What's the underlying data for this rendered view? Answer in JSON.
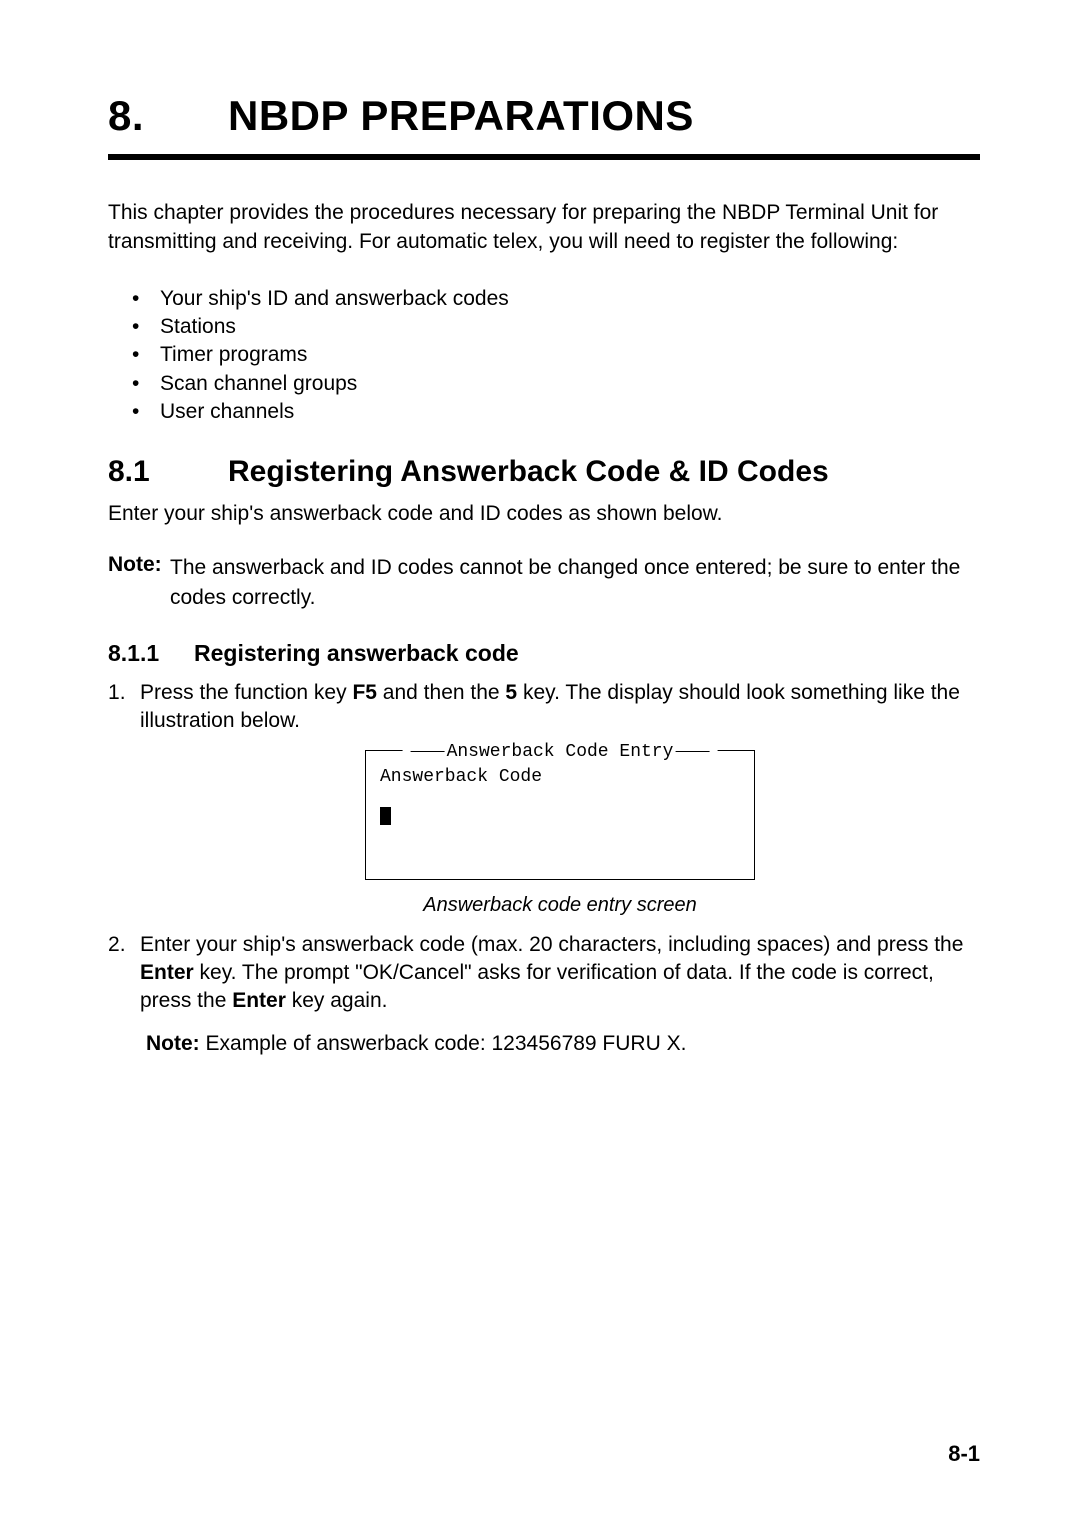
{
  "chapter": {
    "number": "8.",
    "title": "NBDP PREPARATIONS"
  },
  "intro": "This chapter provides the procedures necessary for preparing the NBDP Terminal Unit for transmitting and receiving. For automatic telex, you will need to register the following:",
  "bullets": [
    "Your ship's ID and answerback codes",
    "Stations",
    "Timer programs",
    "Scan channel groups",
    "User channels"
  ],
  "section": {
    "number": "8.1",
    "title": "Registering Answerback Code & ID Codes",
    "para": "Enter your ship's answerback code and ID codes as shown below.",
    "note_label": "Note:",
    "note_body": "The answerback and ID codes cannot be changed once entered; be sure to enter the codes correctly."
  },
  "subsection": {
    "number": "8.1.1",
    "title": "Registering answerback code"
  },
  "step1": {
    "pre": "Press the function key ",
    "k1": "F5",
    "mid": " and then the ",
    "k2": "5",
    "post": " key. The display should look something like the illustration below."
  },
  "terminal": {
    "title": "Answerback Code Entry",
    "line": "Answerback Code"
  },
  "caption": "Answerback code entry screen",
  "step2": {
    "p1": "Enter your ship's answerback code (max. 20 characters, including spaces) and press the ",
    "k1": "Enter",
    "p2": " key. The prompt \"OK/Cancel\" asks for verification of data. If the code is correct, press the ",
    "k2": "Enter",
    "p3": " key again.",
    "note_label": "Note:",
    "note_body": " Example of answerback code: 123456789 FURU X."
  },
  "page_number": "8-1"
}
